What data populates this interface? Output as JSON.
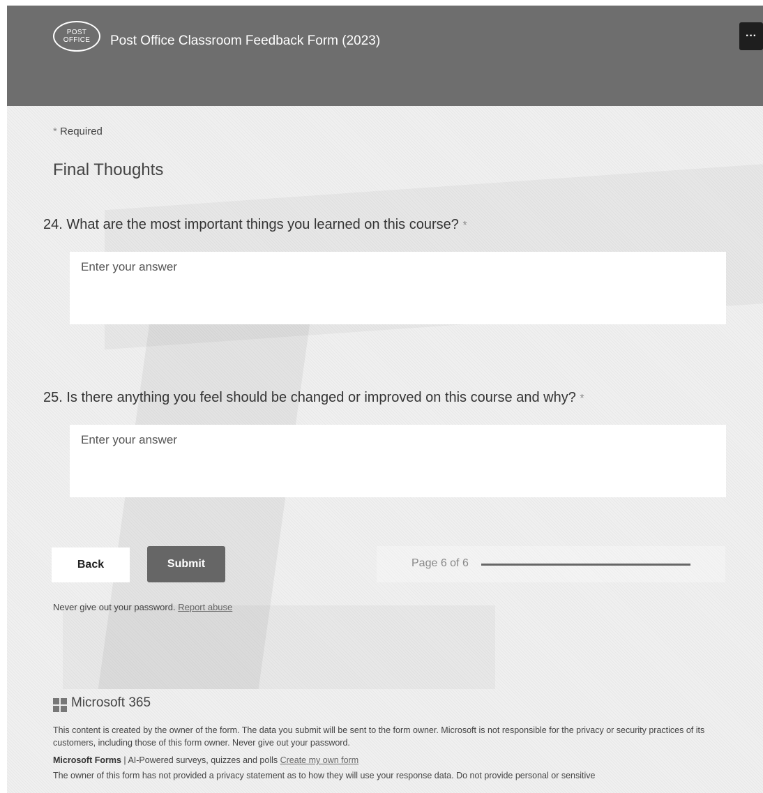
{
  "header": {
    "logo_line1": "POST",
    "logo_line2": "OFFICE",
    "title": "Post Office Classroom Feedback Form (2023)",
    "more_label": "···",
    "background_color": "#6e6e6e"
  },
  "form": {
    "required_marker": "*",
    "required_label": "Required",
    "section_title": "Final Thoughts",
    "questions": [
      {
        "text": "24. What are the most important things you learned on this course?",
        "required_marker": "*",
        "placeholder": "Enter your answer"
      },
      {
        "text": "25. Is there anything you feel should be changed or improved on this course and why?",
        "required_marker": "*",
        "placeholder": "Enter your answer"
      }
    ]
  },
  "nav": {
    "back_label": "Back",
    "submit_label": "Submit",
    "page_label": "Page 6 of 6",
    "progress_fraction": 1.0
  },
  "footer": {
    "password_note": "Never give out your password.",
    "report_link": "Report abuse",
    "brand_name": "Microsoft 365",
    "disclaimer": "This content is created by the owner of the form. The data you submit will be sent to the form owner. Microsoft is not responsible for the privacy or security practices of its customers, including those of this form owner. Never give out your password.",
    "forms_name": "Microsoft Forms",
    "forms_tagline": " | AI-Powered surveys, quizzes and polls ",
    "create_link": "Create my own form",
    "privacy_text": "The owner of this form has not provided a privacy statement as to how they will use your response data. Do not provide personal or sensitive"
  }
}
